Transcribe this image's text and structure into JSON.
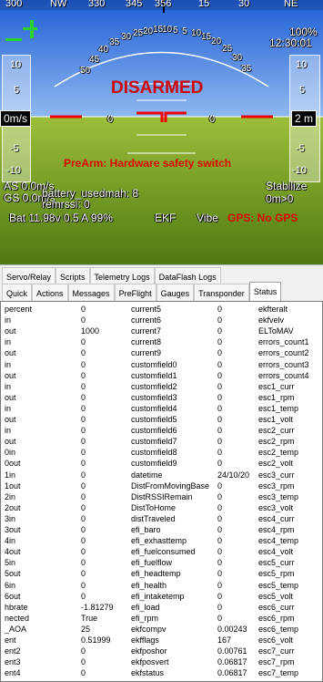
{
  "hud": {
    "heading_labels": [
      "300",
      "NW",
      "330",
      "345",
      "356",
      "15",
      "30",
      "NE"
    ],
    "battery_pct": "100%",
    "time": "12:30:01",
    "pitch_labels": [
      "50",
      "45",
      "40",
      "35",
      "30",
      "25",
      "20",
      "15",
      "10",
      "5",
      "0",
      "5",
      "10",
      "15",
      "20",
      "25",
      "30",
      "35",
      "40",
      "45",
      "50"
    ],
    "speed_ticks": [
      "10",
      "5",
      "0",
      "-5",
      "-10"
    ],
    "alt_ticks": [
      "10",
      "5",
      "0",
      "-5",
      "-10"
    ],
    "speed_box": "0m/s",
    "alt_box": "2 m",
    "armed_status": "DISARMED",
    "prearm_msg": "PreArm: Hardware safety switch",
    "airspeed": "AS 0.0m/s",
    "groundspeed": "GS 0.0m/s",
    "battery_used": "battery_usedmah: 8",
    "remrssi": "remrssi: 0",
    "mode": "Stabilize",
    "wp": "0m>0",
    "battery_info": "Bat 11.98v 0.5 A 99%",
    "ekf": "EKF",
    "vibe": "Vibe",
    "gps": "GPS: No GPS",
    "left_pitch_zero": "0",
    "right_pitch_zero": "0"
  },
  "tabs": {
    "row1": [
      "Servo/Relay",
      "Scripts",
      "Telemetry Logs",
      "DataFlash Logs"
    ],
    "row2": [
      "Quick",
      "Actions",
      "Messages",
      "PreFlight",
      "Gauges",
      "Transponder",
      "Status"
    ],
    "active": "Status"
  },
  "status_rows": [
    [
      "percent",
      "0",
      "current5",
      "0",
      "ekfteralt"
    ],
    [
      "in",
      "0",
      "current6",
      "0",
      "ekfvelv"
    ],
    [
      "out",
      "1000",
      "current7",
      "0",
      "ELToMAV"
    ],
    [
      "in",
      "0",
      "current8",
      "0",
      "errors_count1"
    ],
    [
      "out",
      "0",
      "current9",
      "0",
      "errors_count2"
    ],
    [
      "in",
      "0",
      "customfield0",
      "0",
      "errors_count3"
    ],
    [
      "out",
      "0",
      "customfield1",
      "0",
      "errors_count4"
    ],
    [
      "in",
      "0",
      "customfield2",
      "0",
      "esc1_curr"
    ],
    [
      "out",
      "0",
      "customfield3",
      "0",
      "esc1_rpm"
    ],
    [
      "in",
      "0",
      "customfield4",
      "0",
      "esc1_temp"
    ],
    [
      "out",
      "0",
      "customfield5",
      "0",
      "esc1_volt"
    ],
    [
      "in",
      "0",
      "customfield6",
      "0",
      "esc2_curr"
    ],
    [
      "out",
      "0",
      "customfield7",
      "0",
      "esc2_rpm"
    ],
    [
      "0in",
      "0",
      "customfield8",
      "0",
      "esc2_temp"
    ],
    [
      "0out",
      "0",
      "customfield9",
      "0",
      "esc2_volt"
    ],
    [
      "1in",
      "0",
      "datetime",
      "24/10/20",
      "esc3_curr"
    ],
    [
      "1out",
      "0",
      "DistFromMovingBase",
      "0",
      "esc3_rpm"
    ],
    [
      "2in",
      "0",
      "DistRSSIRemain",
      "0",
      "esc3_temp"
    ],
    [
      "2out",
      "0",
      "DistToHome",
      "0",
      "esc3_volt"
    ],
    [
      "3in",
      "0",
      "distTraveled",
      "0",
      "esc4_curr"
    ],
    [
      "3out",
      "0",
      "efi_baro",
      "0",
      "esc4_rpm"
    ],
    [
      "4in",
      "0",
      "efi_exhasttemp",
      "0",
      "esc4_temp"
    ],
    [
      "4out",
      "0",
      "efi_fuelconsumed",
      "0",
      "esc4_volt"
    ],
    [
      "5in",
      "0",
      "efi_fuelflow",
      "0",
      "esc5_curr"
    ],
    [
      "5out",
      "0",
      "efi_headtemp",
      "0",
      "esc5_rpm"
    ],
    [
      "6in",
      "0",
      "efi_health",
      "0",
      "esc5_temp"
    ],
    [
      "6out",
      "0",
      "efi_intaketemp",
      "0",
      "esc5_volt"
    ],
    [
      "hbrate",
      "-1.81279",
      "efi_load",
      "0",
      "esc6_curr"
    ],
    [
      "nected",
      "True",
      "efi_rpm",
      "0",
      "esc6_rpm"
    ],
    [
      "_AOA",
      "25",
      "ekfcompv",
      "0.00243",
      "esc6_temp"
    ],
    [
      "ent",
      "0.51999",
      "ekfflags",
      "167",
      "esc6_volt"
    ],
    [
      "ent2",
      "0",
      "ekfposhor",
      "0.00761",
      "esc7_curr"
    ],
    [
      "ent3",
      "0",
      "ekfposvert",
      "0.06817",
      "esc7_rpm"
    ],
    [
      "ent4",
      "0",
      "ekfstatus",
      "0.06817",
      "esc7_temp"
    ]
  ]
}
